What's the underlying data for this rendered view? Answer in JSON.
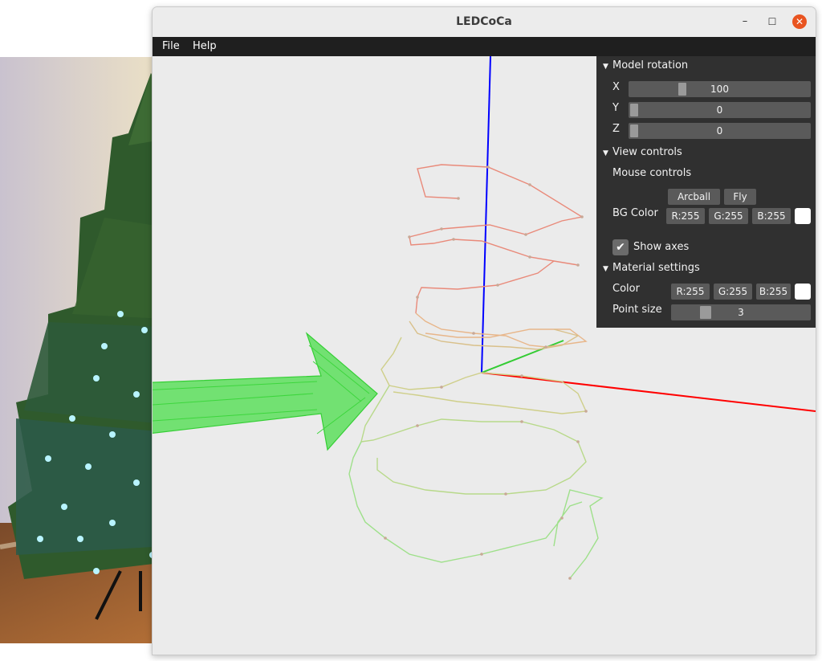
{
  "window": {
    "title": "LEDCoCa"
  },
  "menu": {
    "file": "File",
    "help": "Help"
  },
  "panel": {
    "model_rotation": {
      "header": "Model rotation",
      "x_label": "X",
      "x_value": "100",
      "y_label": "Y",
      "y_value": "0",
      "z_label": "Z",
      "z_value": "0"
    },
    "view_controls": {
      "header": "View controls",
      "mouse_controls": "Mouse controls",
      "arcball": "Arcball",
      "fly": "Fly",
      "bg_color_label": "BG Color",
      "bg_r": "R:255",
      "bg_g": "G:255",
      "bg_b": "B:255",
      "show_axes": "Show axes",
      "show_axes_checked": true
    },
    "material_settings": {
      "header": "Material settings",
      "color_label": "Color",
      "r": "R:255",
      "g": "G:255",
      "b": "B:255",
      "point_size_label": "Point size",
      "point_size_value": "3"
    }
  },
  "colors": {
    "menubar": "#1f1f1f",
    "panel": "#303030",
    "close_button": "#e95420",
    "axis_x": "#ff0000",
    "axis_y": "#00cc00",
    "axis_z": "#0000ff",
    "arrow": "#33dd33"
  }
}
